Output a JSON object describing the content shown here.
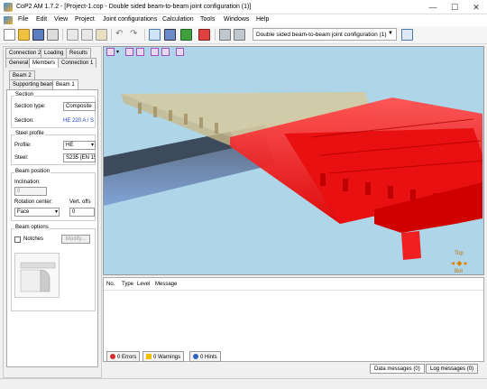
{
  "window": {
    "title": "CoP2 AM 1.7.2 - [Project-1.cop - Double sided beam-to-beam joint configuration (1)]",
    "minimize": "—",
    "maximize": "☐",
    "close": "✕"
  },
  "menu": [
    "File",
    "Edit",
    "View",
    "Project",
    "Joint configurations",
    "Calculation",
    "Tools",
    "Windows",
    "Help"
  ],
  "toolbar": {
    "config_select": "Double sided beam-to-beam joint configuration (1)"
  },
  "left_panel": {
    "tabs_row1": [
      "Connection 2",
      "Loading",
      "Results"
    ],
    "tabs_row2": [
      "General",
      "Members",
      "Connection 1"
    ],
    "subtabs_row1": [
      "Beam 2"
    ],
    "subtabs_row2": [
      "Supporting beam",
      "Beam 1"
    ],
    "section_group": "Section",
    "section_type_label": "Section type:",
    "section_type_value": "Composite",
    "section_label": "Section:",
    "section_value": "HE 220 A / S",
    "steel_group": "Steel profile",
    "profile_label": "Profile:",
    "profile_value": "HE",
    "steel_label": "Steel:",
    "steel_value": "S235 (EN 15",
    "position_group": "Beam position",
    "inclination_label": "Inclination:",
    "inclination_value": "0",
    "rotation_label": "Rotation center:",
    "rotation_value": "Face",
    "vert_offset_label": "Vert. offs",
    "vert_offset_value": "0",
    "options_group": "Beam options",
    "notches_label": "Notches",
    "modify_label": "Modify..."
  },
  "messages": {
    "headers": [
      "No.",
      "Type",
      "Level",
      "Message"
    ],
    "errors_btn": "0 Errors",
    "warnings_btn": "0 Warnings",
    "hints_btn": "0 Hints"
  },
  "bottom_tabs": [
    "Data messages (0)",
    "Log messages (0)"
  ],
  "colors": {
    "viewport_bg": "#aed6e8",
    "beam_red": "#f01010",
    "slab_tan": "#d8c89a",
    "beam_blue": "#7b9fd6",
    "beam_dark": "#3c4a5c"
  }
}
